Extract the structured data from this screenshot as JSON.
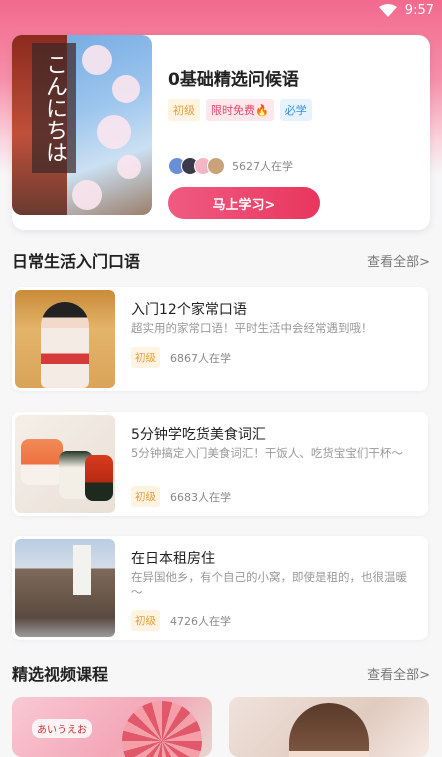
{
  "status": {
    "time": "9:57"
  },
  "hero": {
    "image_text": "こんにちは",
    "title": "0基础精选问候语",
    "tags": {
      "level": "初级",
      "free": "限时免费🔥",
      "must": "必学"
    },
    "learners": "5627人在学",
    "button": "马上学习>"
  },
  "section1": {
    "title": "日常生活入门口语",
    "see_all": "查看全部>"
  },
  "courses": [
    {
      "title": "入门12个家常口语",
      "desc": "超实用的家常口语！平时生活中会经常遇到哦！",
      "level": "初级",
      "learners": "6867人在学"
    },
    {
      "title": "5分钟学吃货美食词汇",
      "desc": "5分钟搞定入门美食词汇！干饭人、吃货宝宝们干杯～",
      "level": "初级",
      "learners": "6683人在学"
    },
    {
      "title": "在日本租房住",
      "desc": "在异国他乡，有个自己的小窝，即使是租的，也很温暖～",
      "level": "初级",
      "learners": "4726人在学"
    }
  ],
  "section2": {
    "title": "精选视频课程",
    "see_all": "查看全部>"
  },
  "video_cards": [
    {
      "label": "あいうえお"
    }
  ],
  "colors": {
    "accent": "#e8365e",
    "tag_level": "#e7a13b",
    "tag_free": "#e8466b",
    "tag_must": "#3a8fd8"
  }
}
